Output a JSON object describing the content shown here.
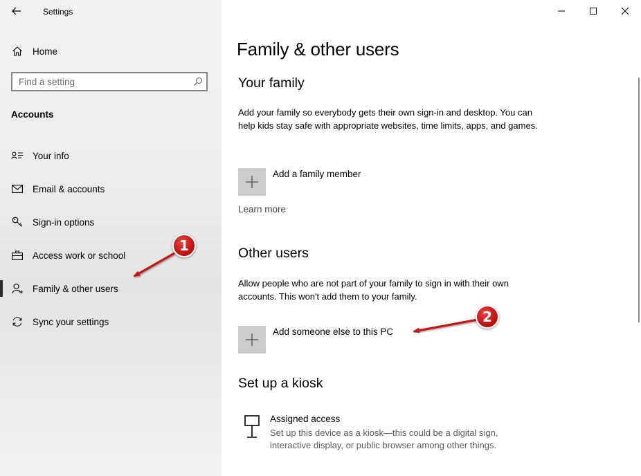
{
  "window": {
    "app_title": "Settings",
    "back_icon": "back-arrow-icon",
    "caption": {
      "minimize_icon": "minimize-icon",
      "maximize_icon": "maximize-icon",
      "close_icon": "close-icon"
    }
  },
  "sidebar": {
    "home_label": "Home",
    "search_placeholder": "Find a setting",
    "section_heading": "Accounts",
    "items": [
      {
        "label": "Your info",
        "icon": "contact-card-icon"
      },
      {
        "label": "Email & accounts",
        "icon": "mail-icon"
      },
      {
        "label": "Sign-in options",
        "icon": "key-icon"
      },
      {
        "label": "Access work or school",
        "icon": "briefcase-icon"
      },
      {
        "label": "Family & other users",
        "icon": "person-add-icon",
        "selected": true
      },
      {
        "label": "Sync your settings",
        "icon": "sync-icon"
      }
    ]
  },
  "main": {
    "page_title": "Family & other users",
    "your_family": {
      "heading": "Your family",
      "description": "Add your family so everybody gets their own sign-in and desktop. You can help kids stay safe with appropriate websites, time limits, apps, and games.",
      "add_label": "Add a family member",
      "learn_more": "Learn more"
    },
    "other_users": {
      "heading": "Other users",
      "description": "Allow people who are not part of your family to sign in with their own accounts. This won't add them to your family.",
      "add_label": "Add someone else to this PC"
    },
    "kiosk": {
      "heading": "Set up a kiosk",
      "item_title": "Assigned access",
      "item_description": "Set up this device as a kiosk—this could be a digital sign, interactive display, or public browser among other things."
    }
  },
  "annotations": {
    "badge_1": "1",
    "badge_2": "2",
    "color": "#c81414"
  }
}
